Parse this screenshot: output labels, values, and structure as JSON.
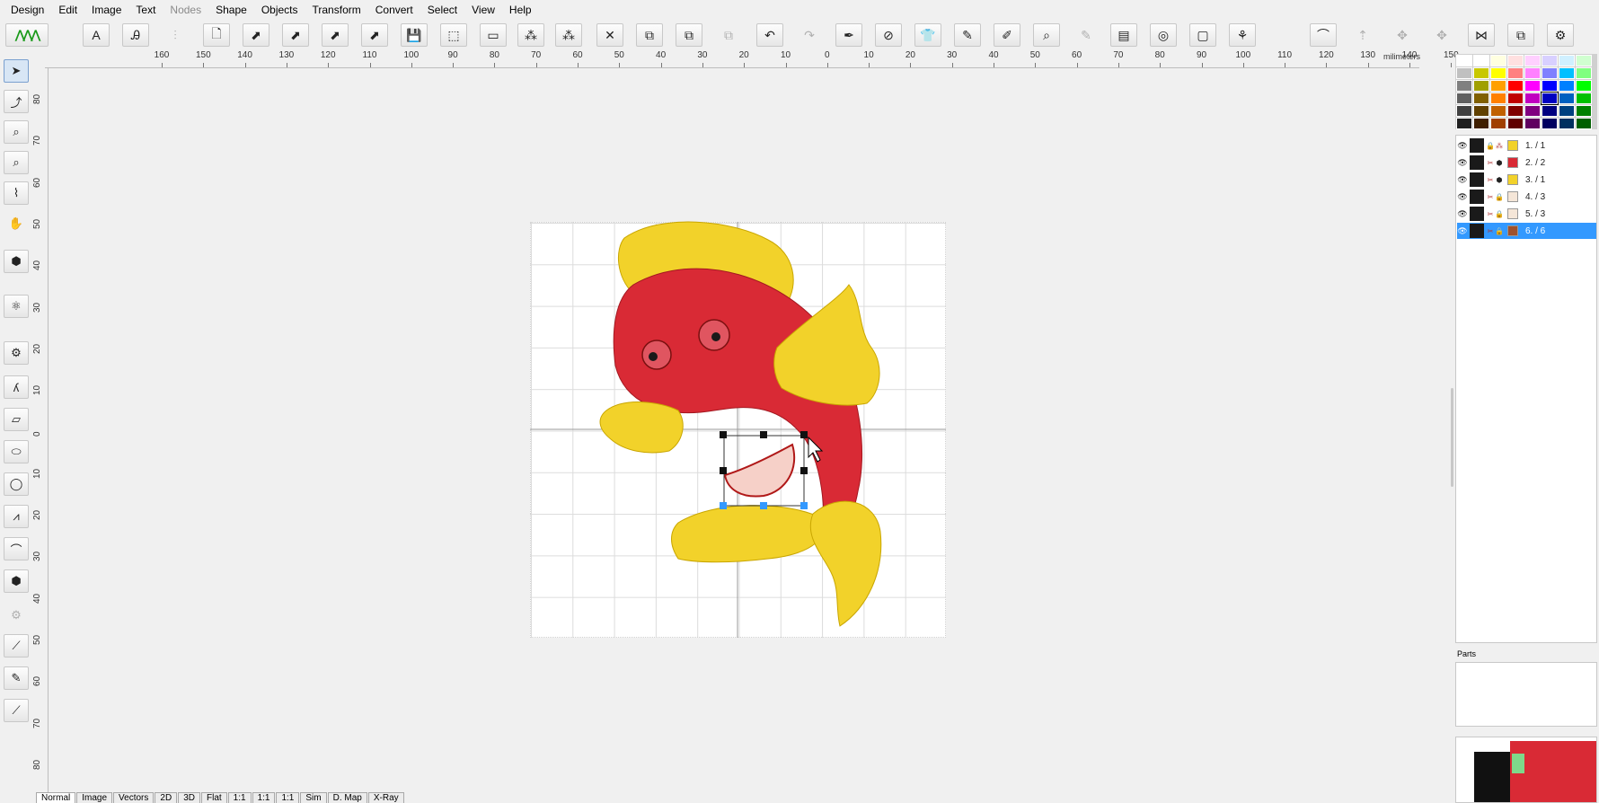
{
  "menu": [
    "Design",
    "Edit",
    "Image",
    "Text",
    "Nodes",
    "Shape",
    "Objects",
    "Transform",
    "Convert",
    "Select",
    "View",
    "Help"
  ],
  "ruler": {
    "unit": "milimeters",
    "top_ticks": [
      "160",
      "150",
      "140",
      "130",
      "120",
      "110",
      "100",
      "90",
      "80",
      "70",
      "60",
      "50",
      "40",
      "30",
      "20",
      "10",
      "0",
      "10",
      "20",
      "30",
      "40",
      "50",
      "60",
      "70",
      "80",
      "90",
      "100",
      "110",
      "120",
      "130",
      "140",
      "150"
    ],
    "left_ticks": [
      "80",
      "70",
      "60",
      "50",
      "40",
      "30",
      "20",
      "10",
      "0",
      "10",
      "20",
      "30",
      "40",
      "50",
      "60",
      "70",
      "80"
    ]
  },
  "colors": {
    "fish_red": "#d92a35",
    "fish_yellow": "#f2d22a",
    "selection_blue": "#3399ff",
    "canvas_bg": "#f0f0f0"
  },
  "palette": [
    "#ffffff",
    "#ffffff",
    "#ffffe0",
    "#ffe0e0",
    "#ffd0ff",
    "#d8d0ff",
    "#d0f0ff",
    "#d0ffd0",
    "#c0c0c0",
    "#c8c800",
    "#ffff00",
    "#ff8080",
    "#ff80ff",
    "#8080ff",
    "#00c0ff",
    "#80ff80",
    "#808080",
    "#a0a000",
    "#ffa000",
    "#ff0000",
    "#ff00ff",
    "#0000ff",
    "#0080ff",
    "#00ff00",
    "#606060",
    "#806000",
    "#ff8000",
    "#c00000",
    "#c000c0",
    "#0000c0",
    "#0060c0",
    "#00c000",
    "#404040",
    "#604000",
    "#c06000",
    "#800000",
    "#800080",
    "#000080",
    "#004080",
    "#008000",
    "#202020",
    "#402000",
    "#a04000",
    "#600000",
    "#600060",
    "#000060",
    "#003060",
    "#006000"
  ],
  "objects": [
    {
      "label": "1. / 1",
      "color": "#f2d22a"
    },
    {
      "label": "2. / 2",
      "color": "#d92a35"
    },
    {
      "label": "3. / 1",
      "color": "#f2d22a"
    },
    {
      "label": "4. / 3",
      "color": "#f5e6d8"
    },
    {
      "label": "5. / 3",
      "color": "#f5e6d8"
    },
    {
      "label": "6. / 6",
      "color": "#a0522d"
    }
  ],
  "parts_label": "Parts",
  "bottom_tabs": [
    "Normal",
    "Image",
    "Vectors",
    "2D",
    "3D",
    "Flat",
    "1:1",
    "1:1",
    "1:1",
    "Sim",
    "D. Map",
    "X-Ray"
  ]
}
